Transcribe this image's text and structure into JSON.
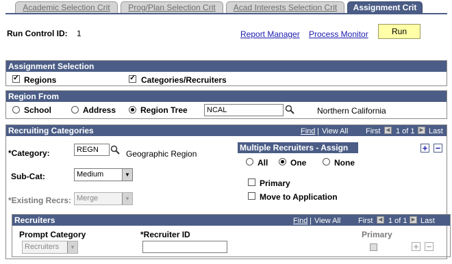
{
  "tabs": [
    {
      "label": "Academic Selection Crit"
    },
    {
      "label": "Prog/Plan Selection Crit"
    },
    {
      "label": "Acad Interests Selection Crit"
    },
    {
      "label": "Assignment Crit"
    }
  ],
  "header": {
    "run_control_label": "Run Control ID:",
    "run_control_value": "1",
    "report_manager": "Report Manager",
    "process_monitor": "Process Monitor",
    "run_label": "Run"
  },
  "assignment_selection": {
    "title": "Assignment Selection",
    "regions_label": "Regions",
    "regions_checked": true,
    "categories_label": "Categories/Recruiters",
    "categories_checked": true
  },
  "region_from": {
    "title": "Region From",
    "options": [
      "School",
      "Address",
      "Region Tree"
    ],
    "selected": "Region Tree",
    "tree_value": "NCAL",
    "tree_description": "Northern California"
  },
  "recruiting_categories": {
    "title": "Recruiting Categories",
    "find": "Find",
    "view_all": "View All",
    "first": "First",
    "counter": "1 of 1",
    "last": "Last",
    "category_label": "*Category:",
    "category_value": "REGN",
    "category_description": "Geographic Region",
    "subcat_label": "Sub-Cat:",
    "subcat_value": "Medium",
    "existing_label": "*Existing Recrs:",
    "existing_value": "Merge",
    "multiple_title": "Multiple Recruiters - Assign",
    "multiple_options": [
      "All",
      "One",
      "None"
    ],
    "multiple_selected": "One",
    "primary_label": "Primary",
    "move_label": "Move to Application"
  },
  "recruiters": {
    "title": "Recruiters",
    "find": "Find",
    "view_all": "View All",
    "first": "First",
    "counter": "1 of 1",
    "last": "Last",
    "prompt_category_label": "Prompt Category",
    "prompt_category_value": "Recruiters",
    "recruiter_id_label": "*Recruiter ID",
    "recruiter_id_value": "",
    "primary_label": "Primary"
  },
  "colors": {
    "header_bg": "#4b5d86",
    "run_button": "#ffffa8",
    "link": "#1a1ab0"
  }
}
